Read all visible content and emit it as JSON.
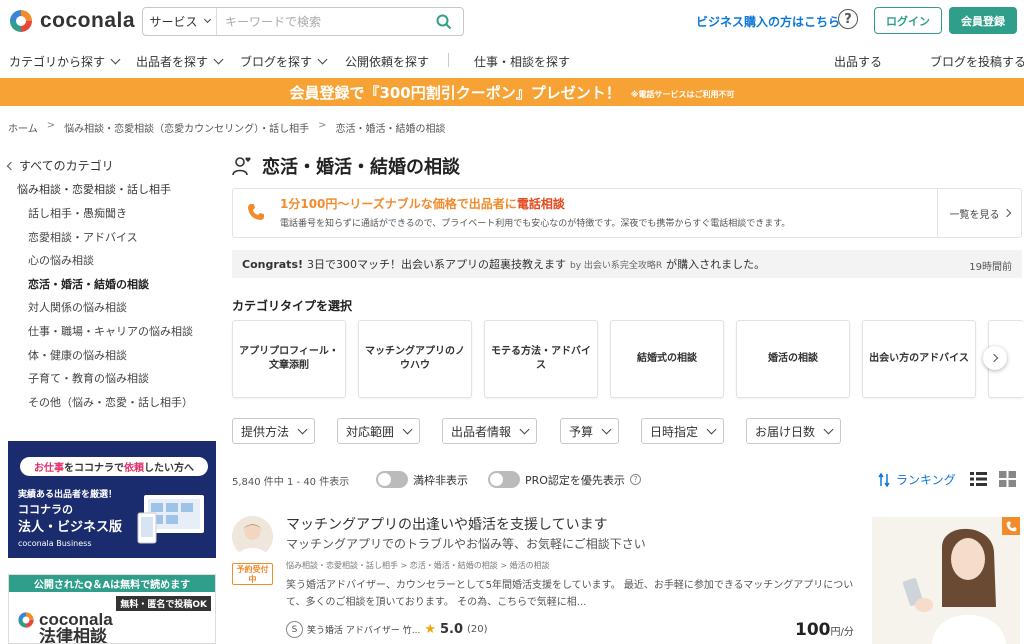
{
  "header": {
    "logo_text": "coconala",
    "search": {
      "category": "サービス",
      "placeholder": "キーワードで検索"
    },
    "biz_link": "ビジネス購入の方はこちら",
    "help": "?",
    "login": "ログイン",
    "signup": "会員登録"
  },
  "nav": {
    "items": [
      "カテゴリから探す",
      "出品者を探す",
      "ブログを探す",
      "公開依頼を探す",
      "仕事・相談を探す",
      "出品する",
      "ブログを投稿する"
    ]
  },
  "banner": {
    "main": "会員登録で『300円割引クーポン』プレゼント！",
    "note": "※電話サービスはご利用不可",
    "color": "#f7a234"
  },
  "breadcrumb": [
    "ホーム",
    "悩み相談・恋愛相談（恋愛カウンセリング）・話し相手",
    "恋活・婚活・結婚の相談"
  ],
  "breadcrumb_sep": ">",
  "sidebar": {
    "all_label": "すべてのカテゴリ",
    "parent": "悩み相談・恋愛相談・話し相手",
    "items": [
      "話し相手・愚痴聞き",
      "恋愛相談・アドバイス",
      "心の悩み相談",
      "恋活・婚活・結婚の相談",
      "対人関係の悩み相談",
      "仕事・職場・キャリアの悩み相談",
      "体・健康の悩み相談",
      "子育て・教育の悩み相談",
      "その他（悩み・恋愛・話し相手）"
    ],
    "active_index": 3
  },
  "ad1": {
    "pill_pre": "お仕事",
    "pill_mid": "をココナラで",
    "pill_em": "依頼",
    "pill_post": "したい方へ",
    "line1": "実績ある出品者を厳選！",
    "line2": "ココナラの",
    "line3": "法人・ビジネス版",
    "line4": "coconala Business"
  },
  "ad2": {
    "top": "公開されたQ＆Aは無料で読めます",
    "tag": "無料・匿名で投稿OK",
    "logo1": "coconala",
    "logo2": "法律相談"
  },
  "page": {
    "title": "恋活・婚活・結婚の相談",
    "promo_title_pre": "1分100円〜リーズナブルな価格で出品者に",
    "promo_title_em": "電話相談",
    "promo_desc": "電話番号を知らずに通話ができるので、プライベート利用でも安心なのが特徴です。深夜でも携帯からすぐ電話相談できます。",
    "promo_link": "一覧を見る",
    "notice_head": "Congrats!",
    "notice_body": "3日で300マッチ！出会い系アプリの超裏技教えます",
    "notice_by": "by 出会い系完全攻略R",
    "notice_tail": "が購入されました。",
    "notice_time": "19時間前",
    "section_title": "カテゴリタイプを選択",
    "category_cards": [
      "アプリプロフィール・文章添削",
      "マッチングアプリのノウハウ",
      "モテる方法・アドバイス",
      "結婚式の相談",
      "婚活の相談",
      "出会い方のアドバイス"
    ],
    "filters": [
      "提供方法",
      "対応範囲",
      "出品者情報",
      "予算",
      "日時指定",
      "お届け日数"
    ],
    "count": "5,840 件中 1 - 40 件表示",
    "toggle1": "満枠非表示",
    "toggle2": "PRO認定を優先表示",
    "ranking": "ランキング"
  },
  "listing": {
    "badge": "予約受付中",
    "title": "マッチングアプリの出逢いや婚活を支援しています",
    "subtitle": "マッチングアプリでのトラブルやお悩み等、お気軽にご相談下さい",
    "breadcrumb": "悩み相談・恋愛相談・話し相手 > 恋活・婚活・結婚の相談 > 婚活の相談",
    "description": "笑う婚活アドバイザー、カウンセラーとして5年間婚活支援をしています。 最近、お手軽に参加できるマッチングアプリについて、多くのご相談を頂いております。 その為、こちらで気軽に相...",
    "seller": "笑う婚活 アドバイザー 竹...",
    "rating": "5.0",
    "reviews": "(20)",
    "price": "100",
    "price_unit": "円/分"
  },
  "colors": {
    "accent": "#2f9e8b",
    "link": "#0c77d8",
    "orange": "#f18b2c"
  }
}
